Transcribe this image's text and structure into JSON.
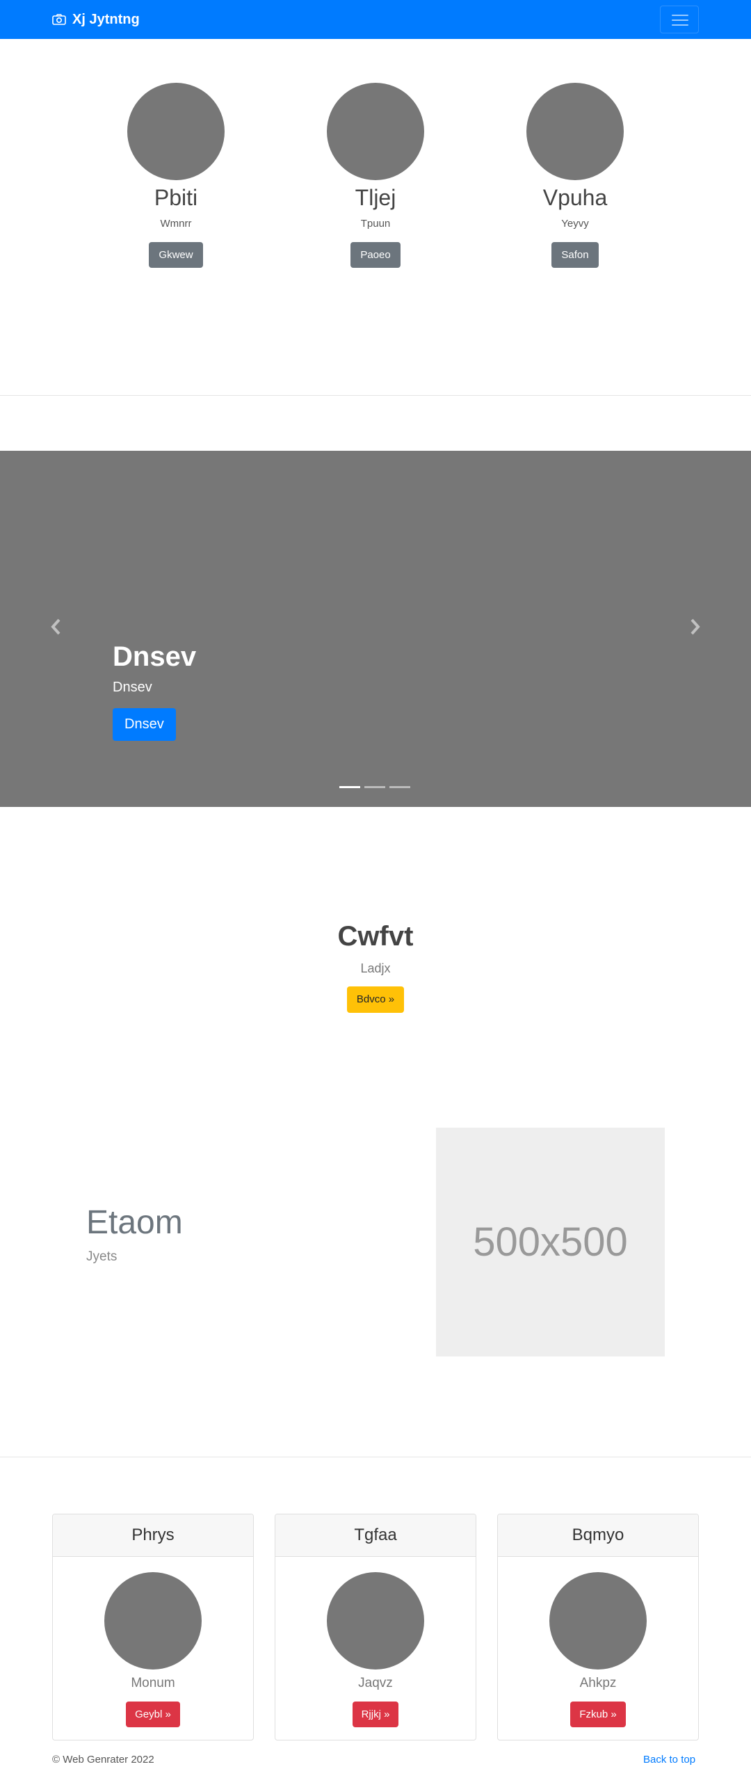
{
  "navbar": {
    "brand": "Xj Jytntng",
    "brand_icon": "camera-icon",
    "toggler_icon": "hamburger-menu-icon",
    "color": "#007bff"
  },
  "profiles": [
    {
      "name": "Pbiti",
      "subtitle": "Wmnrr",
      "button": "Gkwew"
    },
    {
      "name": "Tljej",
      "subtitle": "Tpuun",
      "button": "Paoeo"
    },
    {
      "name": "Vpuha",
      "subtitle": "Yeyvy",
      "button": "Safon"
    }
  ],
  "carousel": {
    "title": "Dnsev",
    "subtitle": "Dnsev",
    "button": "Dnsev",
    "prev_icon": "chevron-left-icon",
    "next_icon": "chevron-right-icon",
    "slide_count": 3,
    "active_slide": 1
  },
  "cta": {
    "title": "Cwfvt",
    "subtitle": "Ladjx",
    "button": "Bdvco »"
  },
  "feature": {
    "title": "Etaom",
    "subtitle": "Jyets",
    "image_placeholder": "500x500"
  },
  "cards": [
    {
      "header": "Phrys",
      "text": "Monum",
      "button": "Geybl »"
    },
    {
      "header": "Tgfaa",
      "text": "Jaqvz",
      "button": "Rjjkj »"
    },
    {
      "header": "Bqmyo",
      "text": "Ahkpz",
      "button": "Fzkub »"
    }
  ],
  "footer": {
    "copyright": "© Web Genrater 2022",
    "back_to_top": "Back to top"
  }
}
